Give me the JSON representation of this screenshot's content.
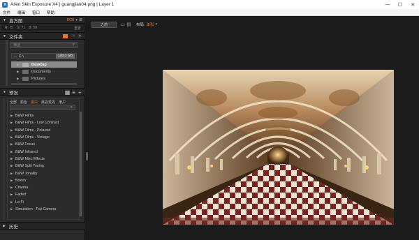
{
  "window": {
    "title": "Alien Skin Exposure X4 | guangjiao04.png | Layer 1",
    "app_icon": "X",
    "controls": [
      "—",
      "☐",
      "✕"
    ]
  },
  "menu": [
    "文件",
    "编辑",
    "窗口",
    "帮助"
  ],
  "histogram": {
    "header": "直方图",
    "mode": "RGB",
    "values": {
      "r": "R: 75",
      "g": "G: 71",
      "b": "B: 50"
    },
    "reset_label": "重置"
  },
  "folders": {
    "header": "文件夹",
    "search_placeholder": "筛选",
    "drive": {
      "name": "C:\\",
      "size": "128.3 GB"
    },
    "items": [
      {
        "label": "Desktop",
        "selected": true
      },
      {
        "label": "Documents",
        "selected": false
      },
      {
        "label": "Pictures",
        "selected": false
      }
    ]
  },
  "presets": {
    "header": "预设",
    "tabs": [
      "全部",
      "颜色",
      "黑白",
      "最喜爱的",
      "用户"
    ],
    "active_tab": "黑白",
    "search_placeholder": "",
    "items": [
      "B&W Films",
      "B&W Films - Low Contrast",
      "B&W Films - Polaroid",
      "B&W Films - Vintage",
      "B&W Focus",
      "B&W Infrared",
      "B&W Misc Effects",
      "B&W Split Toning",
      "B&W Tonality",
      "Bokeh",
      "Cinema",
      "Faded",
      "Lo-Fi",
      "Simulation - Fuji Camera"
    ]
  },
  "history": {
    "header": "历史"
  },
  "toolbar": {
    "before_label": "之前",
    "layout_label": "布局:",
    "layout_value": "单张"
  },
  "colors": {
    "accent": "#e8742a",
    "panel": "#2b2b2b",
    "background": "#1c1c1c"
  }
}
